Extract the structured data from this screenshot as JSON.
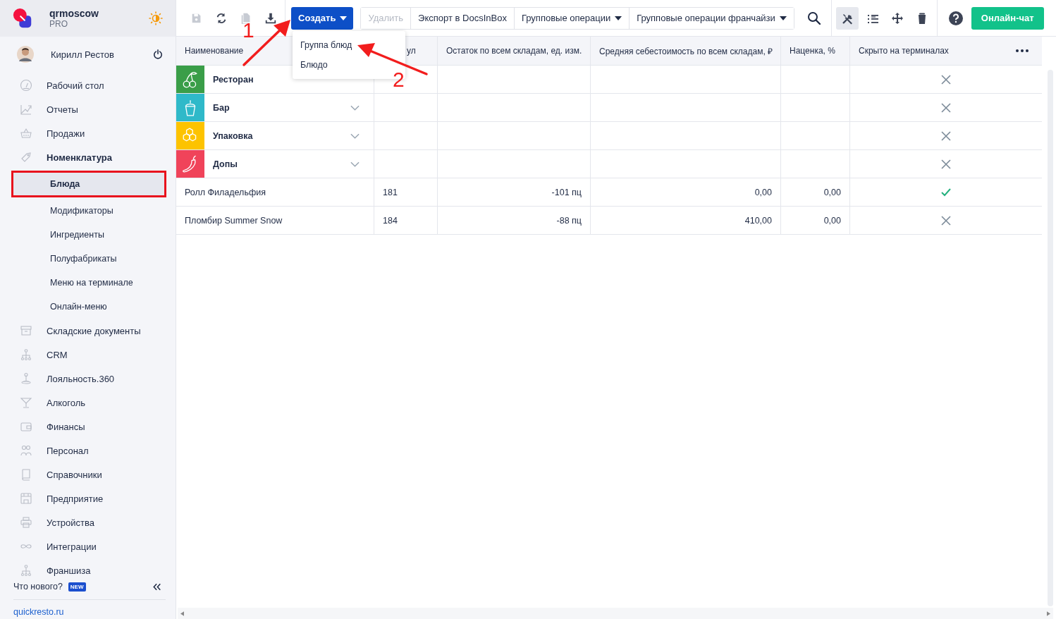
{
  "account": {
    "name": "qrmoscow",
    "plan": "PRO"
  },
  "user": {
    "name": "Кирилл Рестов"
  },
  "sidebar": {
    "items": [
      {
        "label": "Рабочий стол",
        "expanded": false
      },
      {
        "label": "Отчеты",
        "expanded": false
      },
      {
        "label": "Продажи",
        "expanded": false
      },
      {
        "label": "Номенклатура",
        "expanded": true,
        "children": [
          {
            "label": "Блюда",
            "selected": true,
            "highlighted": true
          },
          {
            "label": "Модификаторы",
            "selected": false,
            "highlighted": false
          },
          {
            "label": "Ингредиенты",
            "selected": false,
            "highlighted": false
          },
          {
            "label": "Полуфабрикаты",
            "selected": false,
            "highlighted": false
          },
          {
            "label": "Меню на терминале",
            "selected": false,
            "highlighted": false
          },
          {
            "label": "Онлайн-меню",
            "selected": false,
            "highlighted": false
          }
        ]
      },
      {
        "label": "Складские документы",
        "expanded": false
      },
      {
        "label": "CRM",
        "expanded": false
      },
      {
        "label": "Лояльность.360",
        "expanded": false
      },
      {
        "label": "Алкоголь",
        "expanded": false
      },
      {
        "label": "Финансы",
        "expanded": false
      },
      {
        "label": "Персонал",
        "expanded": false
      },
      {
        "label": "Справочники",
        "expanded": false
      },
      {
        "label": "Предприятие",
        "expanded": false
      },
      {
        "label": "Устройства",
        "expanded": false
      },
      {
        "label": "Интеграции",
        "expanded": false
      },
      {
        "label": "Франшиза",
        "expanded": false
      }
    ],
    "whats_new": "Что нового?",
    "badge": "NEW",
    "link": "quickresto.ru"
  },
  "toolbar": {
    "icon_buttons": [
      {
        "disabled": true
      },
      {
        "disabled": false
      },
      {
        "disabled": true
      },
      {
        "disabled": false
      }
    ],
    "create_button": "Создать",
    "actions": [
      {
        "label": "Удалить",
        "disabled": true,
        "dropdown": false
      },
      {
        "label": "Экспорт в DocsInBox",
        "disabled": false,
        "dropdown": false
      },
      {
        "label": "Групповые операции",
        "disabled": false,
        "dropdown": true
      },
      {
        "label": "Групповые операции франчайзи",
        "disabled": false,
        "dropdown": true
      }
    ],
    "view_tools": [
      {
        "selected": true
      },
      {
        "selected": false
      },
      {
        "selected": false
      },
      {
        "selected": false
      }
    ],
    "chat_button": "Онлайн-чат"
  },
  "create_menu": {
    "items": [
      "Группа блюд",
      "Блюдо"
    ]
  },
  "table": {
    "columns": [
      "Наименование",
      "ул",
      "Остаток по всем складам, ед. изм.",
      "Средняя себестоимость по всем складам, ₽",
      "Наценка, %",
      "Скрыто на терминалах"
    ],
    "groups": [
      {
        "name": "Ресторан",
        "color": "#3a9e48",
        "expand_arrow": false,
        "hidden": false
      },
      {
        "name": "Бар",
        "color": "#2fb9c9",
        "expand_arrow": true,
        "hidden": false
      },
      {
        "name": "Упаковка",
        "color": "#fdc300",
        "expand_arrow": true,
        "hidden": false
      },
      {
        "name": "Допы",
        "color": "#f0435a",
        "expand_arrow": true,
        "hidden": false
      }
    ],
    "rows": [
      {
        "name": "Ролл Филадельфия",
        "code": "181",
        "stock": "-101 пц",
        "cost": "0,00",
        "markup": "0,00",
        "hidden": true
      },
      {
        "name": "Пломбир Summer Snow",
        "code": "184",
        "stock": "-88 пц",
        "cost": "410,00",
        "markup": "0,00",
        "hidden": false
      }
    ]
  },
  "annotations": [
    {
      "label": "1"
    },
    {
      "label": "2"
    }
  ]
}
